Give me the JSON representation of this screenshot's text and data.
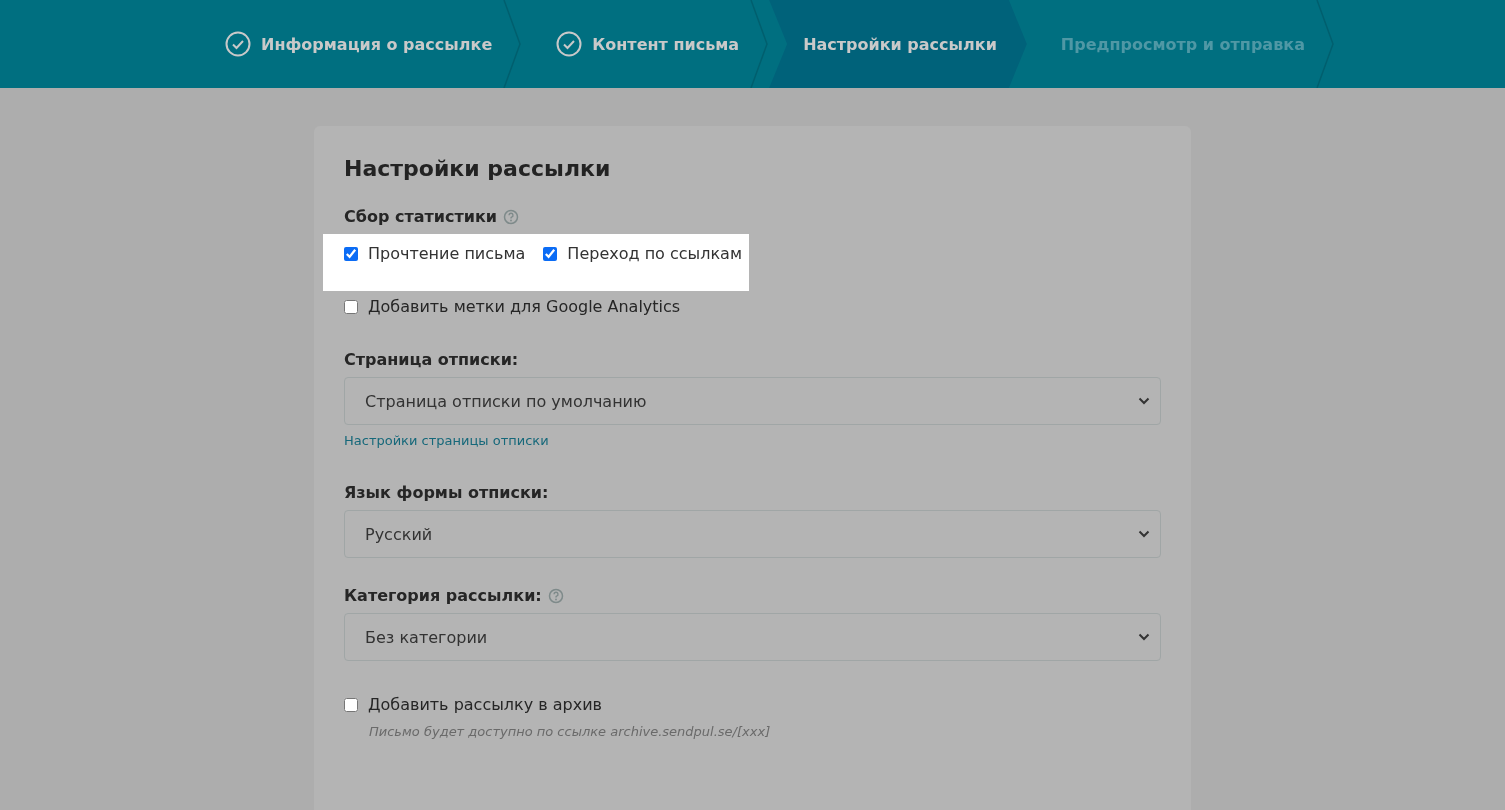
{
  "steps": [
    {
      "label": "Информация о рассылке",
      "done": true,
      "selected": false
    },
    {
      "label": "Контент письма",
      "done": true,
      "selected": false
    },
    {
      "label": "Настройки рассылки",
      "done": false,
      "selected": true
    },
    {
      "label": "Предпросмотр и отправка",
      "done": false,
      "selected": false
    }
  ],
  "card": {
    "title": "Настройки рассылки",
    "statistics": {
      "label": "Сбор статистики",
      "help": true,
      "highlighted": [
        {
          "label": "Прочтение письма",
          "checked": true
        },
        {
          "label": "Переход по ссылкам",
          "checked": true
        }
      ],
      "others": [
        {
          "label": "Добавить метки для Google Analytics",
          "checked": false
        }
      ]
    },
    "selects": [
      {
        "label": "Страница отписки:",
        "help": false,
        "value": "Страница отписки по умолчанию",
        "link": "Настройки страницы отписки"
      },
      {
        "label": "Язык формы отписки:",
        "help": false,
        "value": "Русский"
      },
      {
        "label": "Категория рассылки:",
        "help": true,
        "value": "Без категории"
      }
    ],
    "archive": {
      "label": "Добавить рассылку в архив",
      "checked": false,
      "hint": "Письмо будет доступно по ссылке archive.sendpul.se/[xxx]"
    }
  }
}
